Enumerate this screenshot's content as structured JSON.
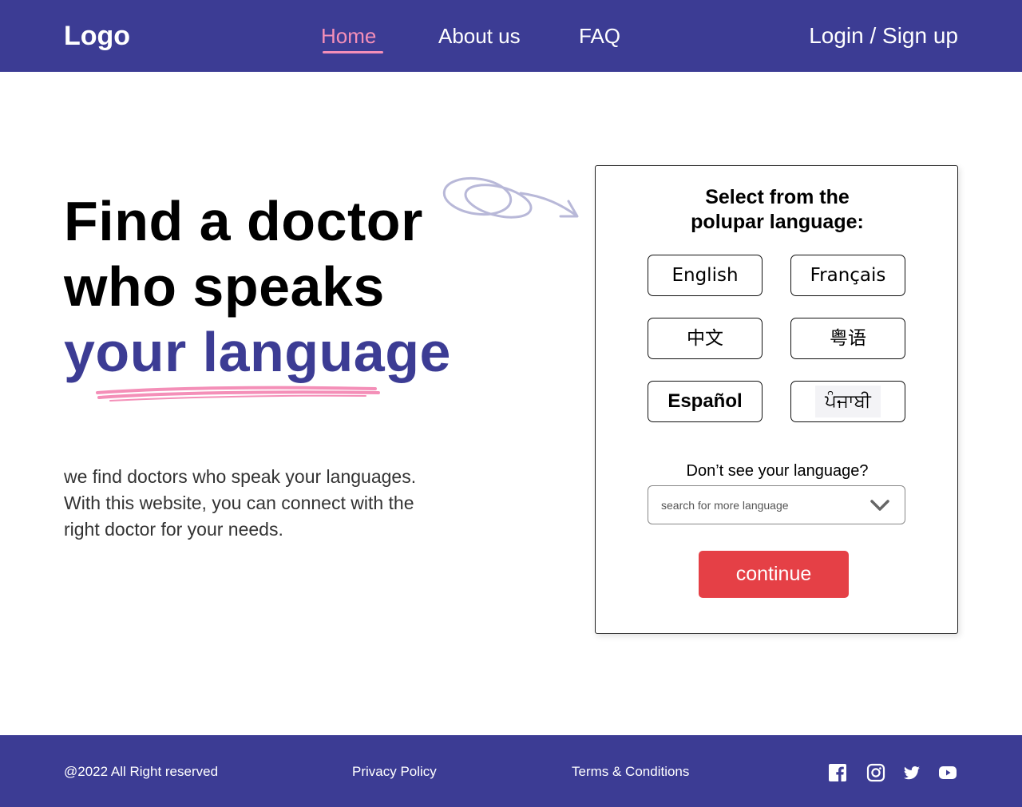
{
  "header": {
    "logo": "Logo",
    "nav": {
      "home": "Home",
      "about": "About us",
      "faq": "FAQ"
    },
    "login": "Login / Sign up"
  },
  "hero": {
    "title_line1": "Find a doctor",
    "title_line2": "who speaks",
    "title_accent": "your language",
    "desc_line1": "we find doctors who speak your languages.",
    "desc_line2": "With this website, you can connect with the",
    "desc_line3": "right doctor for your needs."
  },
  "card": {
    "title_line1": "Select from the",
    "title_line2": "polupar language:",
    "languages": [
      "English",
      "Français",
      "中文",
      "粤语",
      "Español",
      "ਪੰਜਾਬੀ"
    ],
    "dont_see": "Don’t see your language?",
    "search_placeholder": "search for more language",
    "continue": "continue"
  },
  "footer": {
    "copyright": "@2022 All Right reserved",
    "privacy": "Privacy Policy",
    "terms": "Terms & Conditions",
    "social_icons": [
      "facebook-icon",
      "instagram-icon",
      "twitter-icon",
      "youtube-icon"
    ]
  },
  "colors": {
    "brand": "#3c3c94",
    "accent_pink": "#f48fb8",
    "cta_red": "#e54046"
  }
}
